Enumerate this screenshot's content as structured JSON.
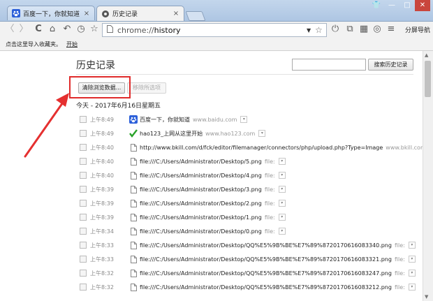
{
  "tabs": [
    {
      "title": "百度一下，你就知道",
      "close": "×",
      "icon": "baidu-paw-icon"
    },
    {
      "title": "历史记录",
      "close": "×",
      "icon": "history-gear-icon"
    }
  ],
  "window_controls": {
    "skin": "👕",
    "minimize": "—",
    "maximize": "□",
    "close": "✕"
  },
  "toolbar": {
    "back": "〈",
    "forward": "〉",
    "reload": "C",
    "home": "⌂",
    "undo": "↶",
    "clock": "◷",
    "star_left": "☆",
    "url_prefix": "chrome://",
    "url_path": "history",
    "dropdown": "▼",
    "star": "☆",
    "power": "⏻",
    "puzzle": "⧉",
    "grid": "▦",
    "account": "◎",
    "menu": "≡",
    "split_nav": "分屏导航"
  },
  "bookmarks_bar": {
    "import_text": "点击这里导入收藏夹。",
    "start_link": "开始"
  },
  "history": {
    "page_title": "历史记录",
    "search_placeholder": "",
    "search_button": "搜索历史记录",
    "clear_button": "清除浏览数据...",
    "remove_button": "移除所选项",
    "date_heading": "今天 - 2017年6月16日星期五",
    "entries": [
      {
        "time": "上午8:49",
        "title": "百度一下，你就知道",
        "domain": "www.baidu.com",
        "icon": "baidu-paw-icon"
      },
      {
        "time": "上午8:49",
        "title": "hao123_上网从这里开始",
        "domain": "www.hao123.com",
        "icon": "hao123-check-icon"
      },
      {
        "time": "上午8:40",
        "title": "http://www.bkill.com/d/fck/editor/filemanager/connectors/php/upload.php?Type=Image",
        "domain": "www.bkill.com",
        "icon": "page-icon"
      },
      {
        "time": "上午8:40",
        "title": "file:///C:/Users/Administrator/Desktop/5.png",
        "domain": "file:",
        "icon": "page-icon"
      },
      {
        "time": "上午8:40",
        "title": "file:///C:/Users/Administrator/Desktop/4.png",
        "domain": "file:",
        "icon": "page-icon"
      },
      {
        "time": "上午8:39",
        "title": "file:///C:/Users/Administrator/Desktop/3.png",
        "domain": "file:",
        "icon": "page-icon"
      },
      {
        "time": "上午8:39",
        "title": "file:///C:/Users/Administrator/Desktop/2.png",
        "domain": "file:",
        "icon": "page-icon"
      },
      {
        "time": "上午8:39",
        "title": "file:///C:/Users/Administrator/Desktop/1.png",
        "domain": "file:",
        "icon": "page-icon"
      },
      {
        "time": "上午8:34",
        "title": "file:///C:/Users/Administrator/Desktop/0.png",
        "domain": "file:",
        "icon": "page-icon"
      },
      {
        "time": "上午8:33",
        "title": "file:///C:/Users/Administrator/Desktop/QQ%E5%9B%BE%E7%89%8720170616083340.png",
        "domain": "file:",
        "icon": "page-icon"
      },
      {
        "time": "上午8:33",
        "title": "file:///C:/Users/Administrator/Desktop/QQ%E5%9B%BE%E7%89%8720170616083321.png",
        "domain": "file:",
        "icon": "page-icon"
      },
      {
        "time": "上午8:32",
        "title": "file:///C:/Users/Administrator/Desktop/QQ%E5%9B%BE%E7%89%8720170616083247.png",
        "domain": "file:",
        "icon": "page-icon"
      },
      {
        "time": "上午8:32",
        "title": "file:///C:/Users/Administrator/Desktop/QQ%E5%9B%BE%E7%89%8720170616083212.png",
        "domain": "file:",
        "icon": "page-icon"
      }
    ]
  },
  "colors": {
    "annotation_red": "#e02b2b",
    "tab_blue": "#aec6e3"
  }
}
